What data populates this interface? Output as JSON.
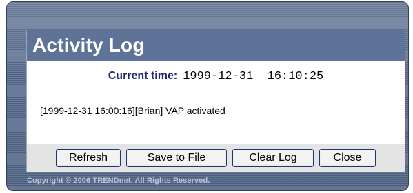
{
  "dialog": {
    "title": "Activity Log",
    "current_time_label": "Current time:",
    "current_time_value": "1999-12-31  16:10:25"
  },
  "log": {
    "entries": [
      "[1999-12-31 16:00:16][Brian] VAP activated"
    ]
  },
  "buttons": {
    "refresh": "Refresh",
    "save_to_file": "Save to File",
    "clear_log": "Clear Log",
    "close": "Close"
  },
  "footer": {
    "copyright": "Copyright © 2006 TRENDnet. All Rights Reserved."
  },
  "colors": {
    "title_bar": "#5e7397",
    "frame": "#4f6283",
    "time_label": "#1d2873",
    "button_border": "#1c3a6e"
  }
}
